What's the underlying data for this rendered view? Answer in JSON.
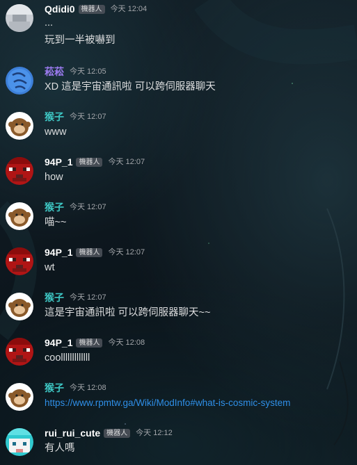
{
  "colors": {
    "link": "#2f8fe8",
    "bot_tag_bg": "#4f545c",
    "username_default": "#ffffff",
    "username_purple": "#9b7bf0",
    "username_teal": "#3ec7c4"
  },
  "messages": [
    {
      "username": "Qdidi0",
      "bot_tag": "機器人",
      "timestamp": "今天 12:04",
      "avatar_icon": "grey-pixel-avatar-icon",
      "lines": [
        "...",
        "玩到一半被嚇到"
      ]
    },
    {
      "username": "菘菘",
      "timestamp": "今天 12:05",
      "avatar_icon": "blue-calligraphy-avatar-icon",
      "lines": [
        "XD 這是宇宙通訊啦 可以跨伺服器聊天"
      ]
    },
    {
      "username": "猴子",
      "timestamp": "今天 12:07",
      "avatar_icon": "monkey-avatar-icon",
      "lines": [
        "www"
      ]
    },
    {
      "username": "94P_1",
      "bot_tag": "機器人",
      "timestamp": "今天 12:07",
      "avatar_icon": "red-pixel-face-avatar-icon",
      "lines": [
        "how"
      ]
    },
    {
      "username": "猴子",
      "timestamp": "今天 12:07",
      "avatar_icon": "monkey-avatar-icon",
      "lines": [
        "喵~~"
      ]
    },
    {
      "username": "94P_1",
      "bot_tag": "機器人",
      "timestamp": "今天 12:07",
      "avatar_icon": "red-pixel-face-avatar-icon",
      "lines": [
        "wt"
      ]
    },
    {
      "username": "猴子",
      "timestamp": "今天 12:07",
      "avatar_icon": "monkey-avatar-icon",
      "lines": [
        "這是宇宙通訊啦 可以跨伺服器聊天~~"
      ]
    },
    {
      "username": "94P_1",
      "bot_tag": "機器人",
      "timestamp": "今天 12:08",
      "avatar_icon": "red-pixel-face-avatar-icon",
      "lines": [
        "coolllllllllllll"
      ]
    },
    {
      "username": "猴子",
      "timestamp": "今天 12:08",
      "avatar_icon": "monkey-avatar-icon",
      "link": "https://www.rpmtw.ga/Wiki/ModInfo#what-is-cosmic-system"
    },
    {
      "username": "rui_rui_cute",
      "bot_tag": "機器人",
      "timestamp": "今天 12:12",
      "avatar_icon": "cyan-pixel-face-avatar-icon",
      "lines": [
        "有人嗎"
      ]
    }
  ]
}
